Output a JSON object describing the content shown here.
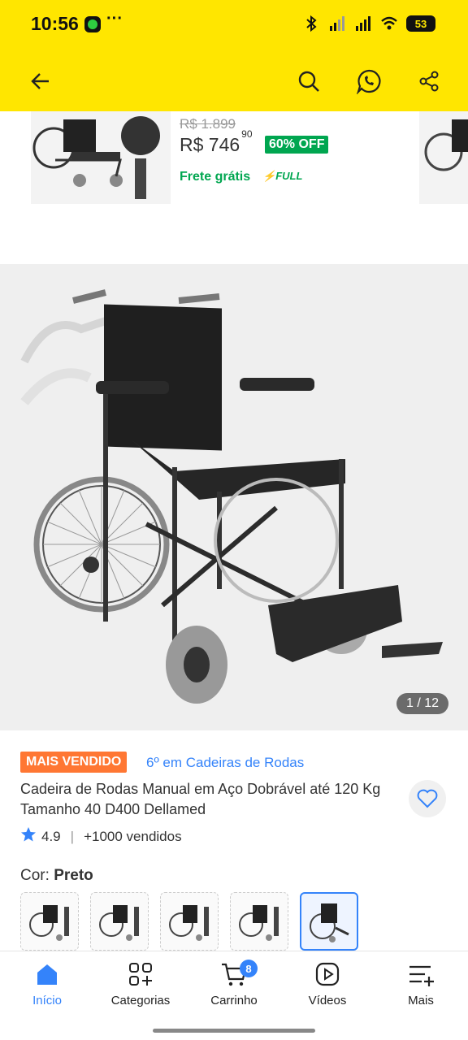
{
  "status_bar": {
    "time": "10:56",
    "ellipsis": "···",
    "battery": "53"
  },
  "related_product": {
    "old_price": "R$ 1.899",
    "price_whole": "R$ 746",
    "price_cents": "90",
    "discount": "60% OFF",
    "shipping": "Frete grátis",
    "full_badge": "FULL"
  },
  "gallery": {
    "counter": "1 / 12"
  },
  "product": {
    "badge": "MAIS VENDIDO",
    "ranking": "6º em Cadeiras de Rodas",
    "title": "Cadeira de Rodas Manual em Aço Dobrável até 120 Kg Tamanho 40 D400 Dellamed",
    "rating": "4.9",
    "sold": "+1000 vendidos",
    "color_label": "Cor:",
    "color_value": "Preto",
    "variant_count": 5,
    "selected_variant": 5
  },
  "bottom_nav": {
    "items": [
      {
        "label": "Início",
        "icon": "home-icon",
        "active": true
      },
      {
        "label": "Categorias",
        "icon": "categories-icon"
      },
      {
        "label": "Carrinho",
        "icon": "cart-icon",
        "badge": "8"
      },
      {
        "label": "Vídeos",
        "icon": "video-icon"
      },
      {
        "label": "Mais",
        "icon": "menu-plus-icon"
      }
    ]
  },
  "colors": {
    "brand_yellow": "#FFE600",
    "accent_blue": "#3483FA",
    "green": "#00A650",
    "orange": "#FF7733"
  }
}
